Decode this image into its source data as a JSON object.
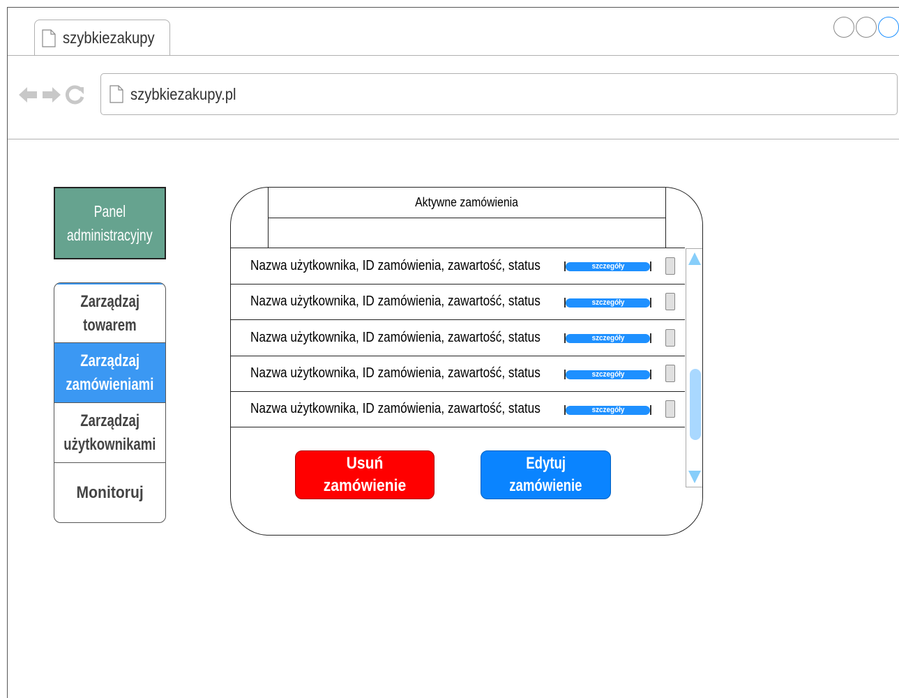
{
  "browser": {
    "tab_title": "szybkiezakupy",
    "url": "szybkiezakupy.pl",
    "icons": [
      "page-icon",
      "back-arrow-icon",
      "forward-arrow-icon",
      "reload-icon"
    ]
  },
  "sidebar": {
    "panel_title_line1": "Panel",
    "panel_title_line2": "administracyjny",
    "items": [
      {
        "line1": "Zarządzaj",
        "line2": "towarem"
      },
      {
        "line1": "Zarządzaj",
        "line2": "zamówieniami",
        "active": true
      },
      {
        "line1": "Zarządzaj",
        "line2": "użytkownikami"
      },
      {
        "line1": "Monitoruj",
        "line2": ""
      }
    ]
  },
  "orders": {
    "title": "Aktywne zamówienia",
    "rows": [
      {
        "text": "Nazwa użytkownika, ID zamówienia, zawartość, status",
        "details": "szczegóły"
      },
      {
        "text": "Nazwa użytkownika, ID zamówienia, zawartość, status",
        "details": "szczegóły"
      },
      {
        "text": "Nazwa użytkownika, ID zamówienia, zawartość, status",
        "details": "szczegóły"
      },
      {
        "text": "Nazwa użytkownika, ID zamówienia, zawartość, status",
        "details": "szczegóły"
      },
      {
        "text": "Nazwa użytkownika, ID zamówienia, zawartość, status",
        "details": "szczegóły"
      }
    ],
    "delete_label": "Usuń zamówienie",
    "edit_label_line1": "Edytuj",
    "edit_label_line2": "zamówienie"
  },
  "colors": {
    "panel_title_bg": "#66a38f",
    "active_menu_bg": "#3b98f3",
    "delete_button": "#ff0000",
    "edit_button": "#0a84ff",
    "details_button": "#1e90ff"
  }
}
